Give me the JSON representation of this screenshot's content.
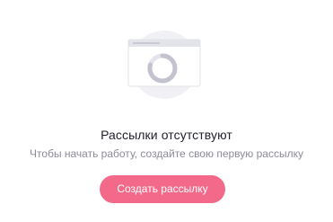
{
  "empty_state": {
    "title": "Рассылки отсутствуют",
    "subtitle": "Чтобы начать работу, создайте свою первую рассылку",
    "illustration_icon": "empty-browser-window-loading-icon",
    "create_button_label": "Создать рассылку"
  },
  "colors": {
    "accent": "#f3698a",
    "title_text": "#1f1f2b",
    "subtitle_text": "#8c8c99",
    "illustration_gray": "#e9e9ef",
    "illustration_dark": "#c9c9d6"
  }
}
